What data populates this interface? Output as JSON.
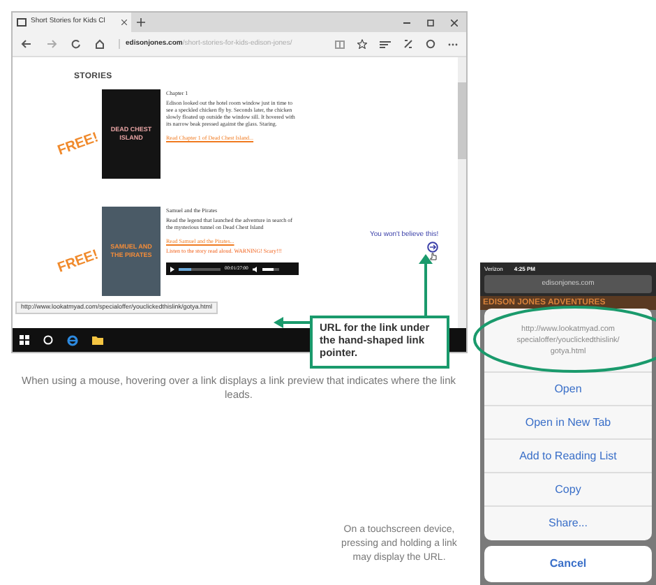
{
  "browser": {
    "tab_title": "Short Stories for Kids Cl",
    "url_domain": "edisonjones.com",
    "url_path": "/short-stories-for-kids-edison-jones/",
    "heading": "STORIES",
    "stories": [
      {
        "badge": "FREE!",
        "cover_title": "DEAD CHEST ISLAND",
        "title": "Chapter 1",
        "summary": "Edison looked out the hotel room window just in time to see a speckled chicken fly by. Seconds later, the chicken slowly floated up outside the window sill. It hovered with its narrow beak pressed against the glass. Staring.",
        "link": "Read Chapter 1 of Dead Chest Island..."
      },
      {
        "badge": "FREE!",
        "cover_title": "SAMUEL AND THE PIRATES",
        "title": "Samuel and the Pirates",
        "summary": "Read the legend that launched the adventure in search of the mysterious tunnel on Dead Chest Island",
        "link": "Read Samuel and the Pirates...",
        "listen": "Listen to the story read aloud. WARNING! Scary!!!",
        "audio": {
          "time": "00:01/27:00",
          "level": 0.3,
          "volume": {
            "level": 0.7
          }
        }
      }
    ],
    "aside_link": "You won't believe this!",
    "status_url": "http://www.lookatmyad.com/specialoffer/youclickedthislink/gotya.html"
  },
  "callout": "URL for the link under the hand-shaped link pointer.",
  "caption_mouse": "When using a mouse, hovering over a link displays a link preview that indicates where the link leads.",
  "caption_touch": "On a touchscreen device, pressing and holding a link may display the URL.",
  "phone": {
    "carrier": "Verizon",
    "time": "4:25 PM",
    "address": "edisonjones.com",
    "banner": "EDISON JONES ADVENTURES",
    "link_url": [
      "http://www.lookatmyad.com",
      "specialoffer/youclickedthislink/",
      "gotya.html"
    ],
    "actions": [
      "Open",
      "Open in New Tab",
      "Add to Reading List",
      "Copy",
      "Share..."
    ],
    "cancel": "Cancel"
  }
}
